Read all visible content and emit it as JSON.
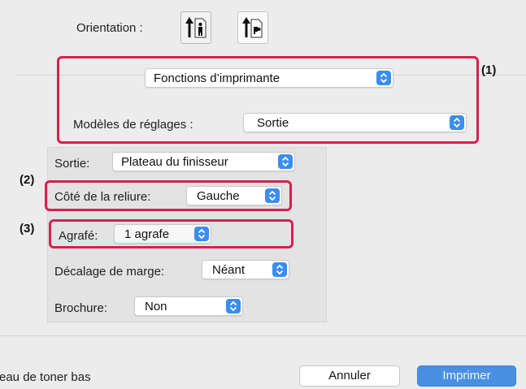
{
  "orientation": {
    "label": "Orientation :",
    "options": [
      {
        "name": "portrait",
        "icon": "portrait-orientation-icon",
        "selected": true
      },
      {
        "name": "landscape",
        "icon": "landscape-orientation-icon",
        "selected": false
      }
    ]
  },
  "feature_popup": {
    "value": "Fonctions d’imprimante"
  },
  "preset": {
    "label": "Modèles de réglages :",
    "value": "Sortie"
  },
  "settings": {
    "output": {
      "label": "Sortie:",
      "value": "Plateau du finisseur"
    },
    "binding_edge": {
      "label": "Côté de la reliure:",
      "value": "Gauche"
    },
    "staple": {
      "label": "Agrafé:",
      "value": "1 agrafe"
    },
    "margin_shift": {
      "label": "Décalage de marge:",
      "value": "Néant"
    },
    "booklet": {
      "label": "Brochure:",
      "value": "Non"
    }
  },
  "callouts": {
    "one": "(1)",
    "two": "(2)",
    "three": "(3)"
  },
  "footer": {
    "status_text": "eau de toner bas",
    "cancel_label": "Annuler",
    "print_label": "Imprimer"
  },
  "colors": {
    "highlight": "#d7204e",
    "accent": "#3b8df0",
    "primary_button": "#4a90e2",
    "background": "#ececec"
  }
}
